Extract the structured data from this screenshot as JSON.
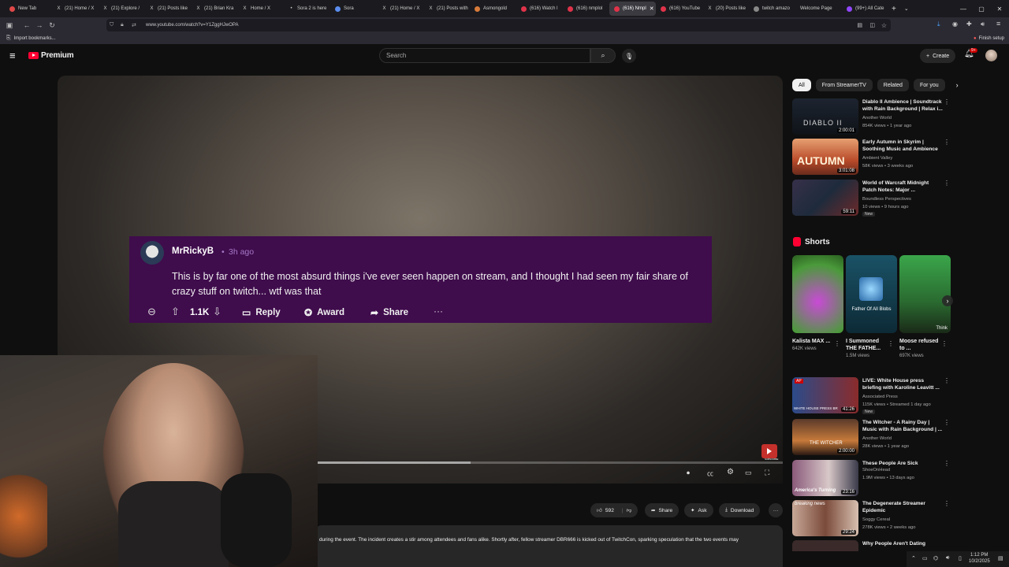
{
  "browser": {
    "tabs": [
      {
        "title": "New Tab"
      },
      {
        "title": "(21) Home / X"
      },
      {
        "title": "(21) Explore /"
      },
      {
        "title": "(21) Posts like"
      },
      {
        "title": "(21) Brian Kra"
      },
      {
        "title": "Home / X"
      },
      {
        "title": "Sora 2 is here"
      },
      {
        "title": "Sora"
      },
      {
        "title": "(21) Home / X"
      },
      {
        "title": "(21) Posts with"
      },
      {
        "title": "Asmongold"
      },
      {
        "title": "(616) Watch l"
      },
      {
        "title": "(616) nmplol"
      },
      {
        "title": "(616) Nmpl"
      },
      {
        "title": "(616) YouTube"
      },
      {
        "title": "(20) Posts like"
      },
      {
        "title": "twitch amazo"
      },
      {
        "title": "Welcome Page"
      },
      {
        "title": "(99+) All Cate"
      }
    ],
    "url": "www.youtube.com/watch?v=Y1ZggHJwOPA",
    "bookmark_label": "Import bookmarks...",
    "finish_setup": "Finish setup"
  },
  "youtube": {
    "logo_text": "Premium",
    "search_placeholder": "Search",
    "create_label": "Create",
    "notif_count": "9+",
    "filter_chips": [
      "All",
      "From StreamerTV",
      "Related",
      "For you"
    ],
    "shorts_title": "Shorts"
  },
  "overlay_comment": {
    "username": "MrRickyB",
    "time": "3h ago",
    "text": "This is by far one of the most absurd things i've ever seen happen on stream, and I thought I had seen my fair share of crazy stuff on twitch... wtf was that",
    "upvotes": "1.1K",
    "reply": "Reply",
    "award": "Award",
    "share": "Share"
  },
  "player": {
    "subscribe_label": "SUBSCRIBE"
  },
  "actions": {
    "likes": "592",
    "share": "Share",
    "ask": "Ask",
    "download": "Download"
  },
  "description": "during the event. The incident creates a stir among attendees and fans alike. Shortly after, fellow streamer DBR666 is kicked out of TwitchCon, sparking speculation that the two events may",
  "recommended_top": [
    {
      "title": "Diablo II Ambience | Soundtrack with Rain Background | Relax i...",
      "channel": "Another World",
      "meta": "854K views • 1 year ago",
      "duration": "2:00:01",
      "thumb_text": "DIABLO II"
    },
    {
      "title": "Early Autumn in Skyrim | Soothing Music and Ambience",
      "channel": "Ambient Valley",
      "meta": "58K views • 3 weeks ago",
      "duration": "3:01:08",
      "thumb_text": "AUTUMN"
    },
    {
      "title": "World of Warcraft Midnight Patch Notes: Major ...",
      "channel": "Boundless Perspectives",
      "meta": "10 views • 9 hours ago",
      "duration": "59:11",
      "badge": "New"
    }
  ],
  "shorts": [
    {
      "title": "Kalista MAX ...",
      "views": "642K views"
    },
    {
      "title": "I Summoned THE FATHE...",
      "views": "1.5M views",
      "thumb_text": "Father Of All Blobs"
    },
    {
      "title": "Moose refused to ...",
      "views": "697K views",
      "thumb_text": "Think"
    }
  ],
  "recommended_bottom": [
    {
      "title": "LIVE: White House press briefing with Karoline Leavitt ...",
      "channel": "Associated Press",
      "meta": "115K views • Streamed 1 day ago",
      "duration": "41:26",
      "badge": "New",
      "thumb_text": "WHITE HOUSE PRESS BR"
    },
    {
      "title": "The Witcher - A Rainy Day | Music with Rain Background | ...",
      "channel": "Another World",
      "meta": "28K views • 1 year ago",
      "duration": "2:00:00",
      "thumb_text": "THE WITCHER"
    },
    {
      "title": "These People Are Sick",
      "channel": "ShoeOnHead",
      "meta": "1.9M views • 13 days ago",
      "duration": "23:16",
      "thumb_text": "America's Turning"
    },
    {
      "title": "The Degenerate Streamer Epidemic",
      "channel": "Soggy Cereal",
      "meta": "278K views • 2 weeks ago",
      "duration": "29:24",
      "thumb_text": "breaking news"
    },
    {
      "title": "Why People Aren't Dating"
    }
  ],
  "taskbar": {
    "time": "1:12 PM",
    "date": "10/2/2025"
  },
  "colors": {
    "comment_bg": "#3f0c4c",
    "comment_accent": "#a579c7",
    "yt_red": "#ff0033"
  }
}
